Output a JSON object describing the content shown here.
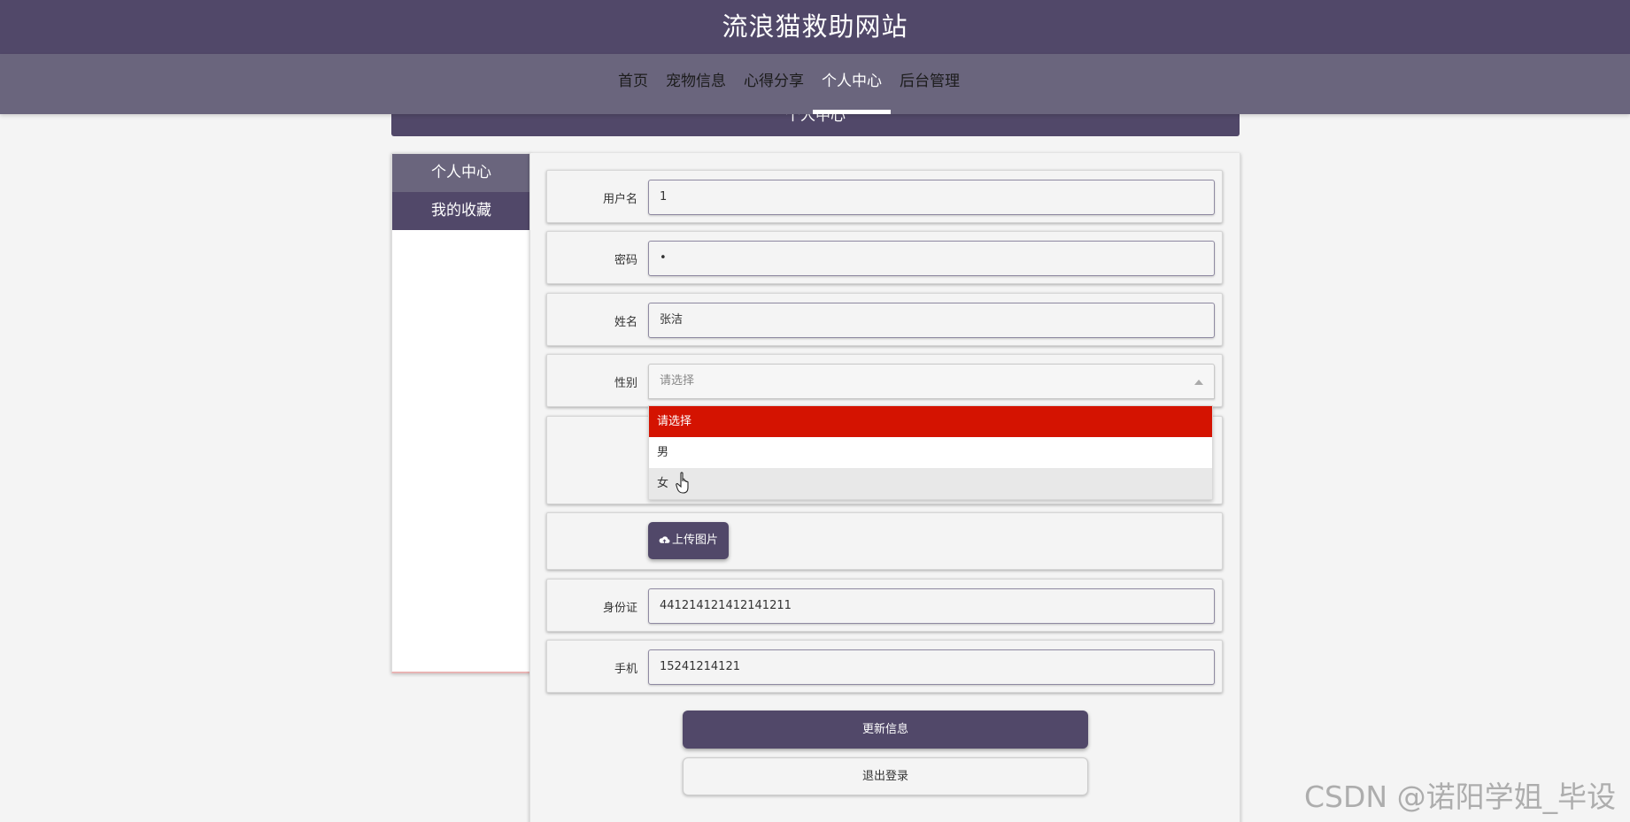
{
  "header": {
    "site_title": "流浪猫救助网站"
  },
  "nav": {
    "items": [
      {
        "label": "首页"
      },
      {
        "label": "宠物信息"
      },
      {
        "label": "心得分享"
      },
      {
        "label": "个人中心",
        "active": true
      },
      {
        "label": "后台管理"
      }
    ]
  },
  "section_title": "个人中心",
  "sidebar": {
    "items": [
      {
        "label": "个人中心",
        "active": true
      },
      {
        "label": "我的收藏"
      }
    ]
  },
  "form": {
    "username": {
      "label": "用户名",
      "value": "1"
    },
    "password": {
      "label": "密码",
      "value": "•"
    },
    "name": {
      "label": "姓名",
      "value": "张洁"
    },
    "gender": {
      "label": "性别",
      "placeholder": "请选择",
      "options": [
        "请选择",
        "男",
        "女"
      ],
      "selected_option": "请选择",
      "hovered_option": "女"
    },
    "upload_button": "上传图片",
    "id_card": {
      "label": "身份证",
      "value": "441214121412141211"
    },
    "phone": {
      "label": "手机",
      "value": "15241214121"
    }
  },
  "buttons": {
    "update": "更新信息",
    "logout": "退出登录"
  },
  "colors": {
    "header_bg": "#514869",
    "nav_bg": "#6a657d",
    "selected_option_bg": "#d41301"
  },
  "icons": {
    "upload": "cloud-upload-icon",
    "cursor": "hand-pointer-icon"
  },
  "watermark": "CSDN @诺阳学姐_毕设"
}
